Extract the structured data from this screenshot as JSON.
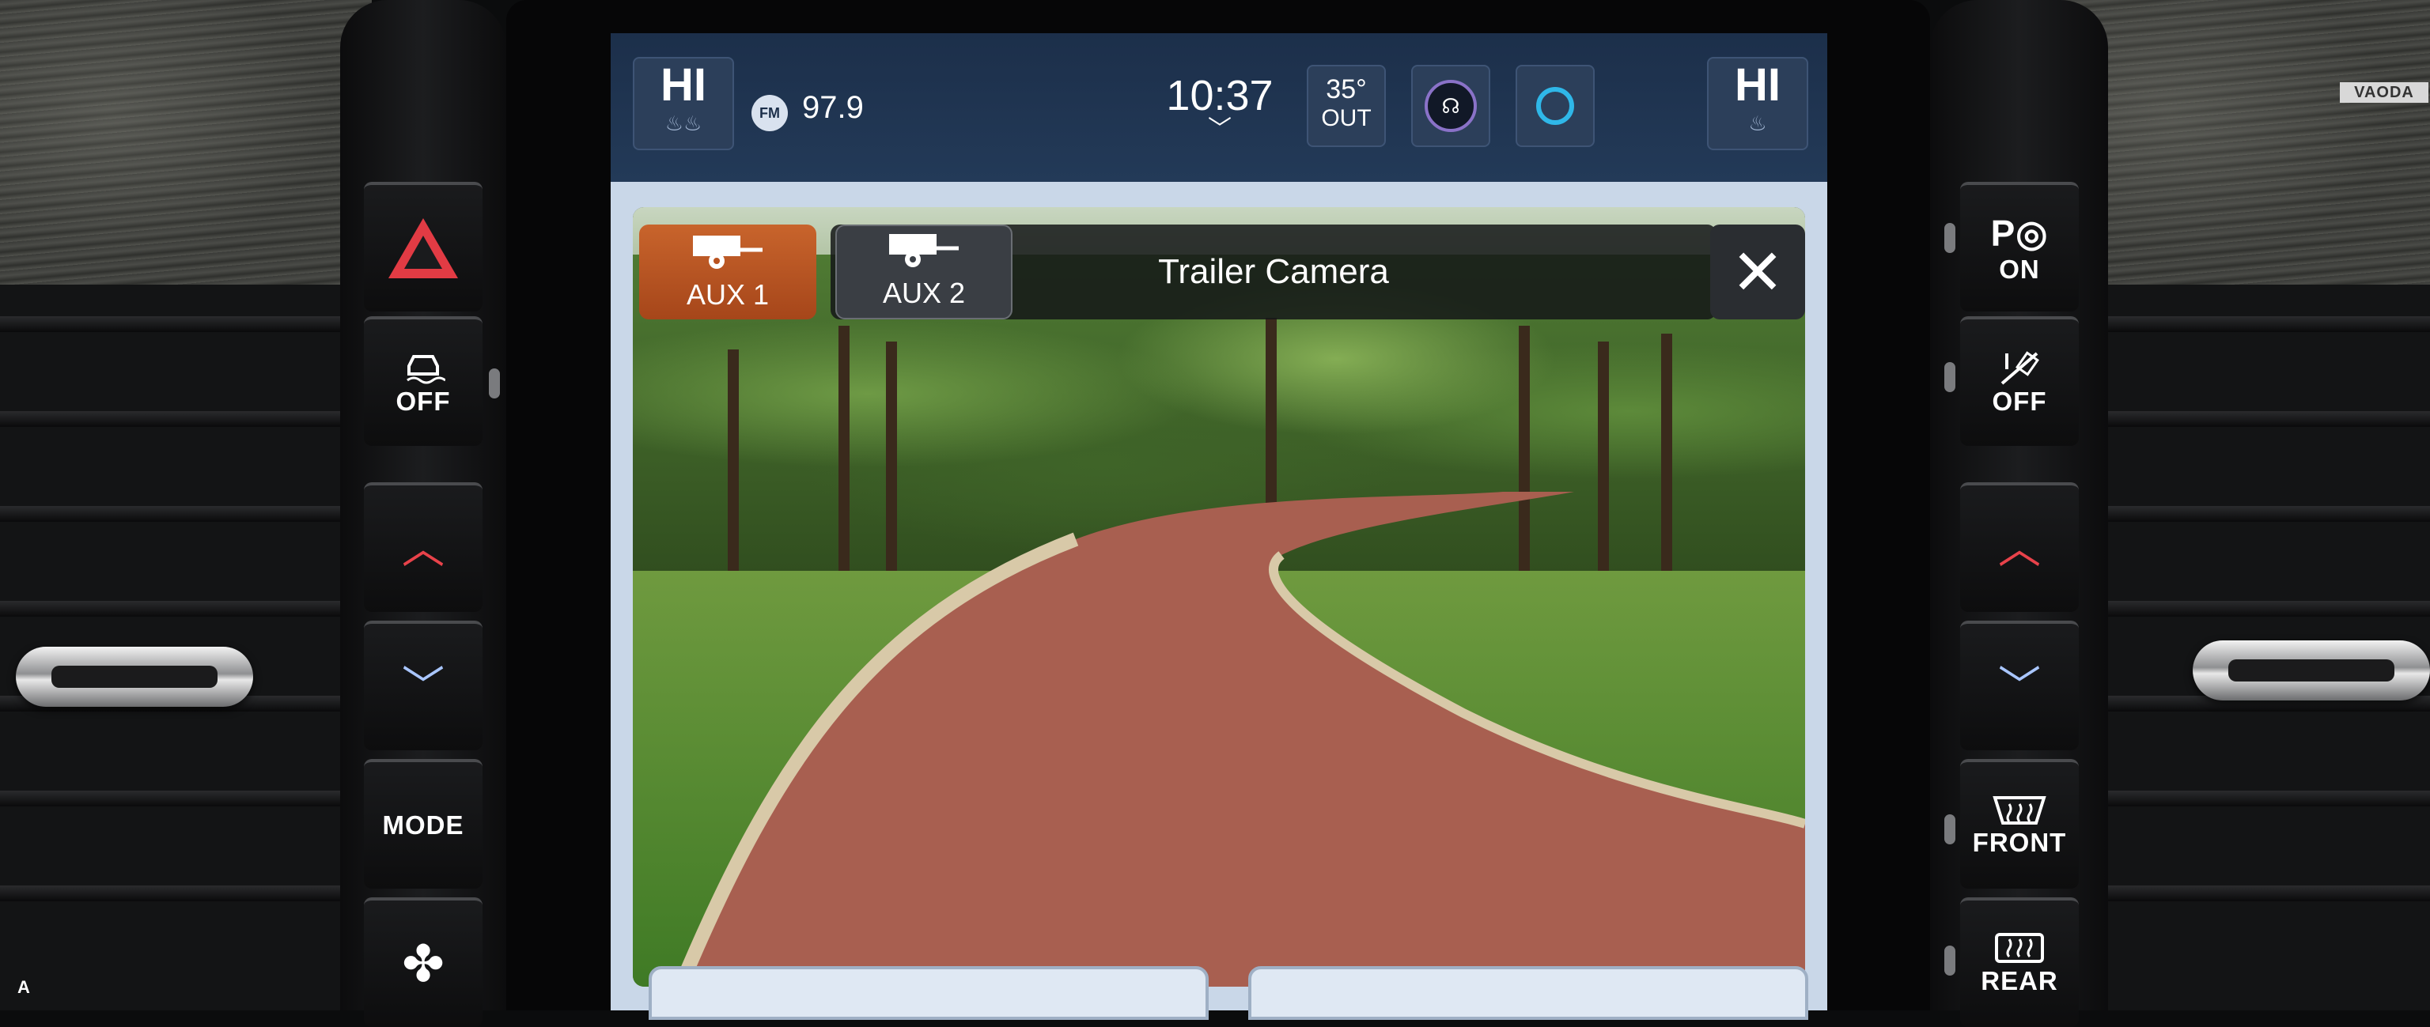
{
  "statusbar": {
    "left_climate": "HI",
    "radio_band": "FM",
    "radio_frequency": "97.9",
    "time": "10:37",
    "outside_temp": "35°",
    "outside_temp_label": "OUT",
    "right_climate": "HI"
  },
  "camera": {
    "title": "Trailer Camera",
    "aux1_label": "AUX 1",
    "aux2_label": "AUX 2",
    "close_icon": "close-icon"
  },
  "left_panel": {
    "traction_off": "OFF",
    "mode_label": "MODE"
  },
  "right_panel": {
    "park_assist_on": "ON",
    "hill_descent_off": "OFF",
    "defrost_front": "FRONT",
    "defrost_rear": "REAR"
  },
  "watermark": "VAODA",
  "figure_letter": "A",
  "colors": {
    "active_aux": "#c25a26",
    "hazard_red": "#e23b44",
    "chevron_up": "#e8424a",
    "chevron_down": "#a9c6ff",
    "statusbar_bg": "#1c2f4a"
  }
}
